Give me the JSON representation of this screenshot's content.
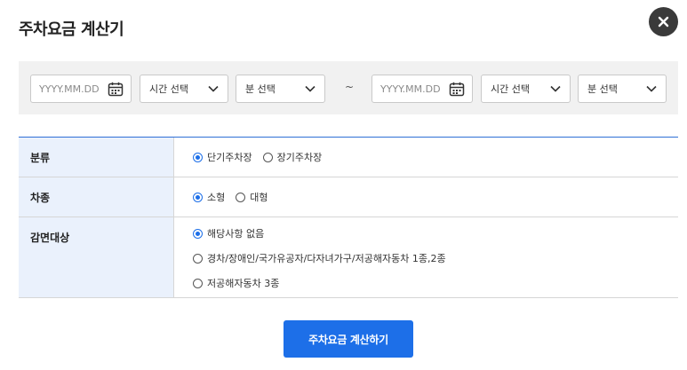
{
  "dialog": {
    "title": "주차요금 계산기"
  },
  "date_range": {
    "start": {
      "date_placeholder": "YYYY.MM.DD",
      "hour_select": "시간 선택",
      "minute_select": "분 선택"
    },
    "separator": "~",
    "end": {
      "date_placeholder": "YYYY.MM.DD",
      "hour_select": "시간 선택",
      "minute_select": "분 선택"
    }
  },
  "options": {
    "category": {
      "label": "분류",
      "choices": [
        {
          "label": "단기주차장",
          "checked": true
        },
        {
          "label": "장기주차장",
          "checked": false
        }
      ]
    },
    "vehicle": {
      "label": "차종",
      "choices": [
        {
          "label": "소형",
          "checked": true
        },
        {
          "label": "대형",
          "checked": false
        }
      ]
    },
    "discount": {
      "label": "감면대상",
      "choices": [
        {
          "label": "해당사항 없음",
          "checked": true
        },
        {
          "label": "경차/장애인/국가유공자/다자녀가구/저공해자동차 1종,2종",
          "checked": false
        },
        {
          "label": "저공해자동차 3종",
          "checked": false
        }
      ]
    }
  },
  "actions": {
    "calculate_label": "주차요금 계산하기"
  },
  "colors": {
    "accent": "#1d6fe8",
    "header_bg": "#eaf1fc",
    "close_bg": "#3a3a3a",
    "date_bar_bg": "#f1f1f1"
  },
  "icons": {
    "close": "close-icon",
    "calendar": "calendar-icon",
    "dropdown": "chevron-down-icon"
  }
}
